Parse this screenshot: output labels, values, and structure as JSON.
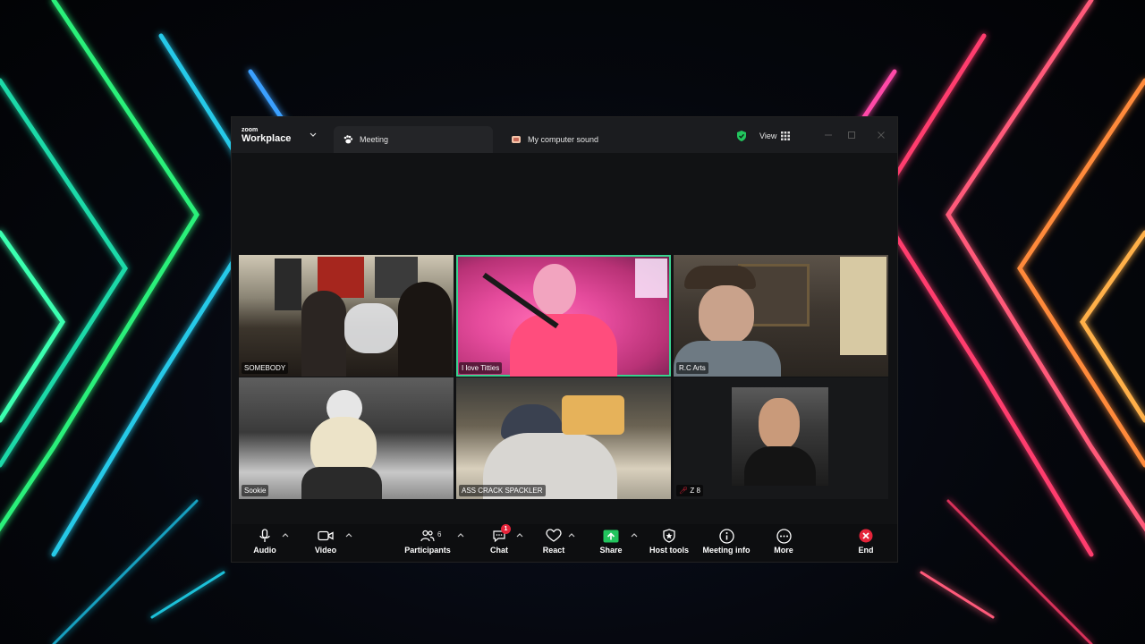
{
  "window": {
    "brand_small": "zoom",
    "brand_name": "Workplace",
    "tabs": [
      {
        "label": "Meeting",
        "icon": "paw-icon"
      },
      {
        "label": "My computer sound",
        "icon": "sound-icon"
      }
    ],
    "view_label": "View"
  },
  "participants": [
    {
      "name": "SOMEBODY",
      "active": false
    },
    {
      "name": "I love Titties",
      "active": true
    },
    {
      "name": "R.C Arts",
      "active": false
    },
    {
      "name": "Sookie",
      "active": false
    },
    {
      "name": "ASS CRACK SPACKLER",
      "active": false
    },
    {
      "name": "Z 8",
      "active": false,
      "muted": true
    }
  ],
  "toolbar": {
    "audio_label": "Audio",
    "video_label": "Video",
    "participants_label": "Participants",
    "participants_count": "6",
    "chat_label": "Chat",
    "chat_badge": "1",
    "react_label": "React",
    "share_label": "Share",
    "host_tools_label": "Host tools",
    "meeting_info_label": "Meeting info",
    "more_label": "More",
    "end_label": "End"
  },
  "colors": {
    "active_speaker": "#3ad28f",
    "share_green": "#22c55e",
    "end_red": "#e5243a",
    "shield_green": "#22c55e"
  }
}
